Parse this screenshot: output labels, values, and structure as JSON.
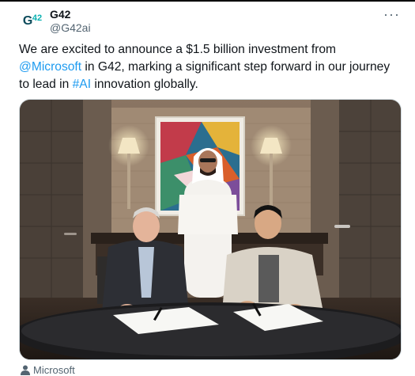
{
  "account": {
    "display_name": "G42",
    "handle": "@G42ai",
    "avatar_letters": "G",
    "avatar_sub": "42"
  },
  "menu": {
    "more_label": "···"
  },
  "tweet": {
    "text_part1": "We are excited to announce a $1.5 billion investment from ",
    "mention": "@Microsoft",
    "text_part2": " in G42, marking a significant step forward in our journey to lead in ",
    "hashtag": "#AI",
    "text_part3": " innovation globally."
  },
  "media": {
    "tagged_user": "Microsoft",
    "tag_icon": "person-icon"
  },
  "colors": {
    "link": "#1d9bf0",
    "text": "#0f1419",
    "muted": "#536471"
  }
}
